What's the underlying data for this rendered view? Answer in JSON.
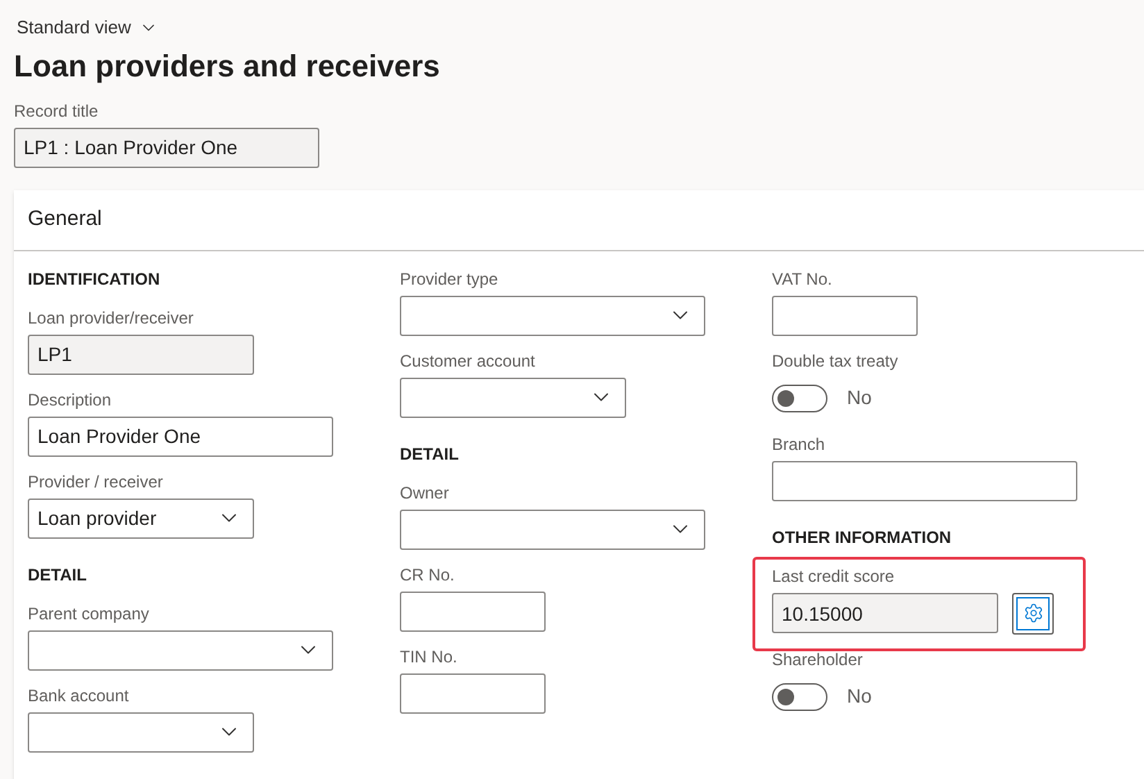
{
  "view_selector": {
    "label": "Standard view"
  },
  "page_title": "Loan providers and receivers",
  "record_title": {
    "label": "Record title",
    "value": "LP1 : Loan Provider One",
    "readonly": true
  },
  "section": {
    "title": "General",
    "columns": [
      [
        {
          "kind": "heading",
          "text": "IDENTIFICATION"
        },
        {
          "kind": "text",
          "label": "Loan provider/receiver",
          "value": "LP1",
          "readonly": true
        },
        {
          "kind": "text",
          "label": "Description",
          "value": "Loan Provider One",
          "readonly": false
        },
        {
          "kind": "select",
          "label": "Provider / receiver",
          "value": "Loan provider"
        },
        {
          "kind": "heading",
          "text": "DETAIL"
        },
        {
          "kind": "select",
          "label": "Parent company"
        },
        {
          "kind": "select",
          "label": "Bank account"
        }
      ],
      [
        {
          "kind": "select",
          "label": "Provider type"
        },
        {
          "kind": "select",
          "label": "Customer account"
        },
        {
          "kind": "heading",
          "text": "DETAIL"
        },
        {
          "kind": "select",
          "label": "Owner"
        },
        {
          "kind": "text",
          "label": "CR No.",
          "readonly": false
        },
        {
          "kind": "text",
          "label": "TIN No.",
          "readonly": false
        }
      ],
      [
        {
          "kind": "text",
          "label": "VAT No.",
          "readonly": false
        },
        {
          "kind": "toggle",
          "label": "Double tax treaty",
          "on": false,
          "state_text": "No"
        },
        {
          "kind": "text",
          "label": "Branch",
          "readonly": false
        },
        {
          "kind": "heading",
          "text": "OTHER INFORMATION"
        },
        {
          "kind": "text",
          "label": "Last credit score",
          "value": "10.15000",
          "readonly": true,
          "highlighted": true,
          "settings_button": true
        },
        {
          "kind": "toggle",
          "label": "Shareholder",
          "on": false,
          "state_text": "No"
        }
      ]
    ]
  }
}
